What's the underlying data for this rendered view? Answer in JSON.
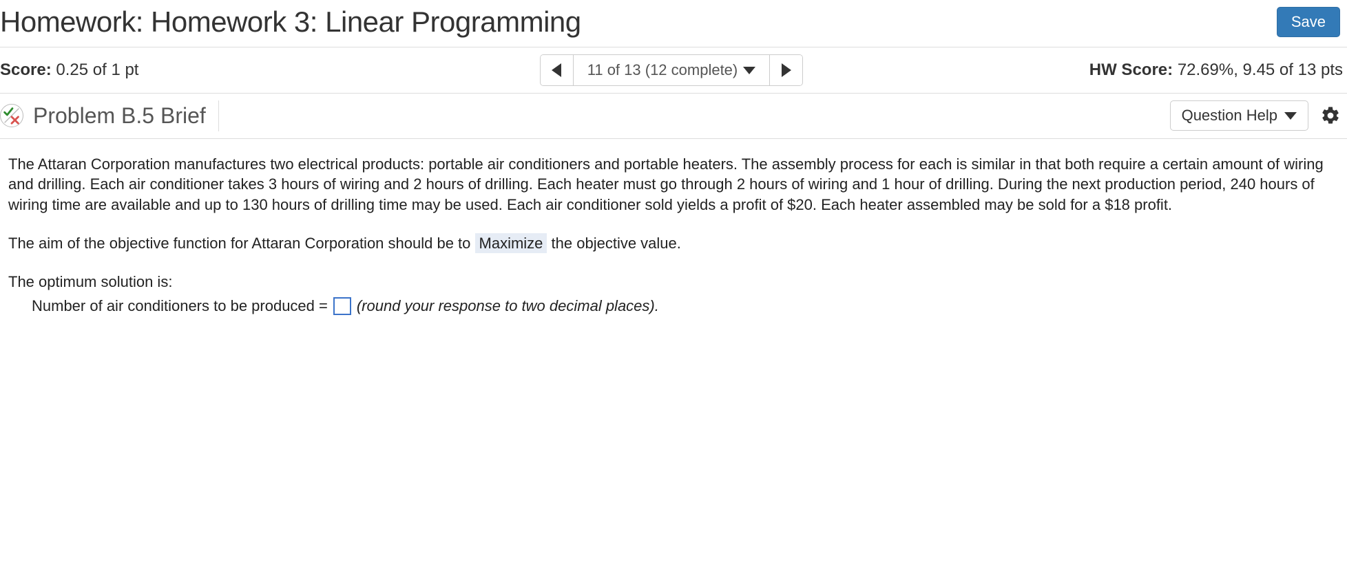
{
  "header": {
    "title": "Homework: Homework 3: Linear Programming",
    "save_label": "Save"
  },
  "score_bar": {
    "score_label": "Score:",
    "score_value": "0.25 of 1 pt",
    "nav_text": "11 of 13 (12 complete)",
    "hw_label": "HW Score:",
    "hw_value": "72.69%, 9.45 of 13 pts"
  },
  "problem": {
    "title": "Problem B.5 Brief",
    "question_help_label": "Question Help"
  },
  "body": {
    "paragraph1": "The Attaran Corporation manufactures two electrical products: portable air conditioners and portable heaters.  The assembly process for each is similar in that both require a certain amount of wiring and drilling.  Each air conditioner takes 3 hours of wiring and 2 hours of drilling. Each heater must go through 2 hours of wiring and 1 hour of drilling. During the next production period, 240 hours of wiring time are available and up to 130 hours of drilling time may be used. Each air conditioner sold yields a profit of $20.  Each heater assembled may be sold for a $18 profit.",
    "objective_prefix": "The aim of the objective function for Attaran Corporation should be to ",
    "objective_choice": "Maximize",
    "objective_suffix": " the objective value.",
    "solution_header": "The optimum solution is:",
    "answer_label": "Number of air conditioners to be produced = ",
    "answer_hint": "(round your response to two decimal places)."
  }
}
